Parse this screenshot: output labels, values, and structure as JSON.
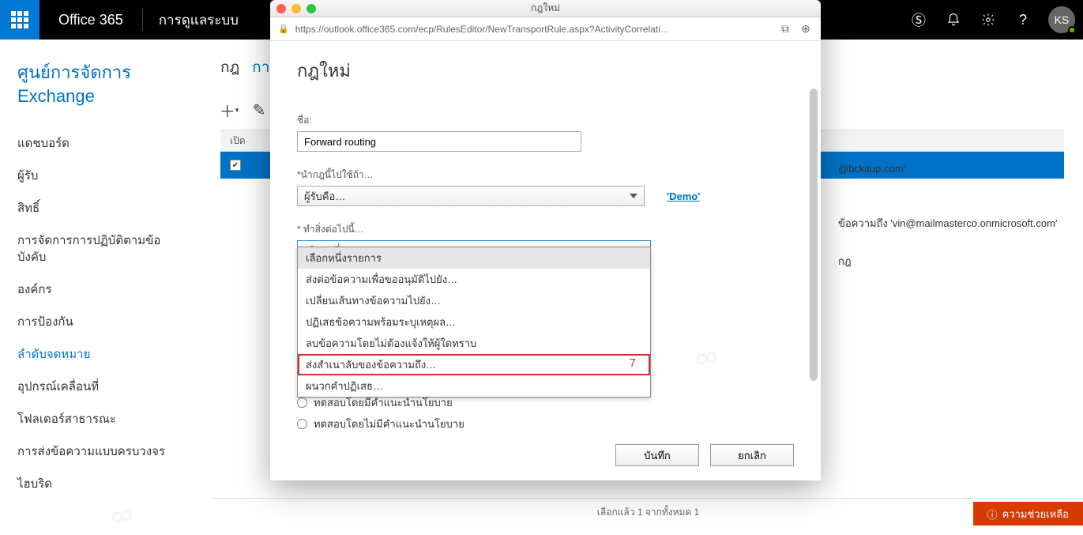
{
  "topbar": {
    "brand": "Office 365",
    "admin": "การดูแลระบบ",
    "avatar": "KS"
  },
  "sidebar": {
    "title": "ศูนย์การจัดการ Exchange",
    "items": [
      {
        "label": "แดชบอร์ด"
      },
      {
        "label": "ผู้รับ"
      },
      {
        "label": "สิทธิ์"
      },
      {
        "label": "การจัดการการปฏิบัติตามข้อบังคับ"
      },
      {
        "label": "องค์กร"
      },
      {
        "label": "การป้องกัน"
      },
      {
        "label": "ลำดับจดหมาย"
      },
      {
        "label": "อุปกรณ์เคลื่อนที่"
      },
      {
        "label": "โฟลเดอร์สาธารณะ"
      },
      {
        "label": "การส่งข้อความแบบครบวงจร"
      },
      {
        "label": "ไฮบริด"
      }
    ],
    "active_index": 6
  },
  "tabs": {
    "active": "กฎ",
    "next": "กา"
  },
  "list": {
    "header": "เปิด"
  },
  "detail": {
    "line1": "@bckitup.com'",
    "line2": "ข้อความถึง 'vin@mailmasterco.onmicrosoft.com'",
    "line3": "กฎ"
  },
  "modal": {
    "window_title": "กฎใหม่",
    "url": "https://outlook.office365.com/ecp/RulesEditor/NewTransportRule.aspx?ActivityCorrelati…",
    "heading": "กฎใหม่",
    "name_label": "ชื่อ:",
    "name_value": "Forward routing",
    "apply_label": "*นำกฎนี้ไปใช้ถ้า…",
    "apply_select": "ผู้รับคือ…",
    "apply_link": "'Demo'",
    "do_label": "* ทำสิ่งต่อไปนี้…",
    "do_select": "เลือกหนึ่งรายการ",
    "dropdown": [
      "เลือกหนึ่งรายการ",
      "ส่งต่อข้อความเพื่อขออนุมัติไปยัง…",
      "เปลี่ยนเส้นทางข้อความไปยัง…",
      "ปฏิเสธข้อความพร้อมระบุเหตุผล…",
      "ลบข้อความโดยไม่ต้องแจ้งให้ผู้ใดทราบ",
      "ส่งสำเนาลับของข้อความถึง…",
      "ผนวกคำปฏิเสธ…"
    ],
    "highlight_num": "7",
    "radios": [
      "ทดสอบโดยมีคำแนะนำนโยบาย",
      "ทดสอบโดยไม่มีคำแนะนำนโยบาย"
    ],
    "save": "บันทึก",
    "cancel": "ยกเลิก"
  },
  "footer": {
    "status": "เลือกแล้ว 1 จากทั้งหมด 1",
    "help": "ความช่วยเหลือ"
  }
}
